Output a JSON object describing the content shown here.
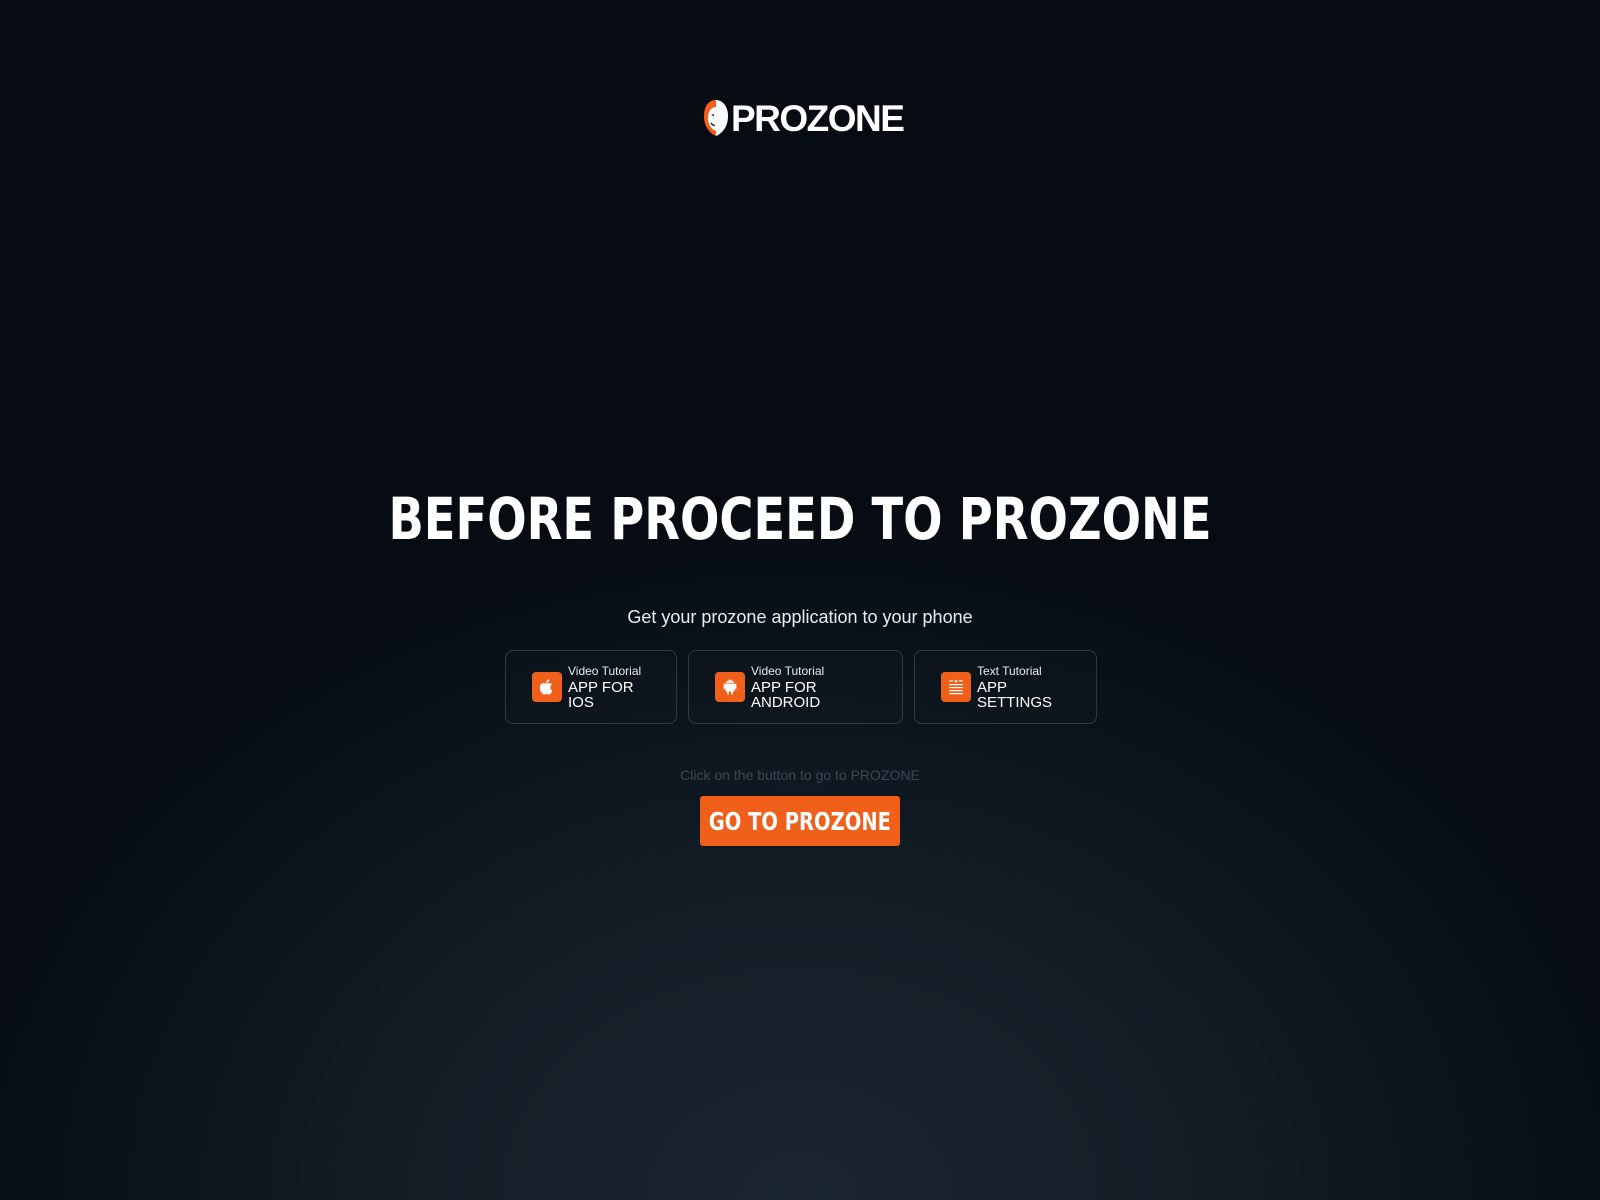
{
  "brand": {
    "logo_text": "PROZONE",
    "logo_icon": "hooded-mask-icon",
    "accent_color": "#f0601b"
  },
  "headline": "BEFORE PROCEED TO PROZONE",
  "subtitle": "Get your prozone application to your phone",
  "cards": [
    {
      "small": "Video Tutorial",
      "title": "APP FOR IOS",
      "icon": "apple-icon"
    },
    {
      "small": "Video Tutorial",
      "title": "APP FOR ANDROID",
      "icon": "android-icon"
    },
    {
      "small": "Text Tutorial",
      "title": "APP SETTINGS",
      "icon": "document-list-icon"
    }
  ],
  "hint": "Click on the button to go to PROZONE",
  "cta_label": "GO TO PROZONE"
}
